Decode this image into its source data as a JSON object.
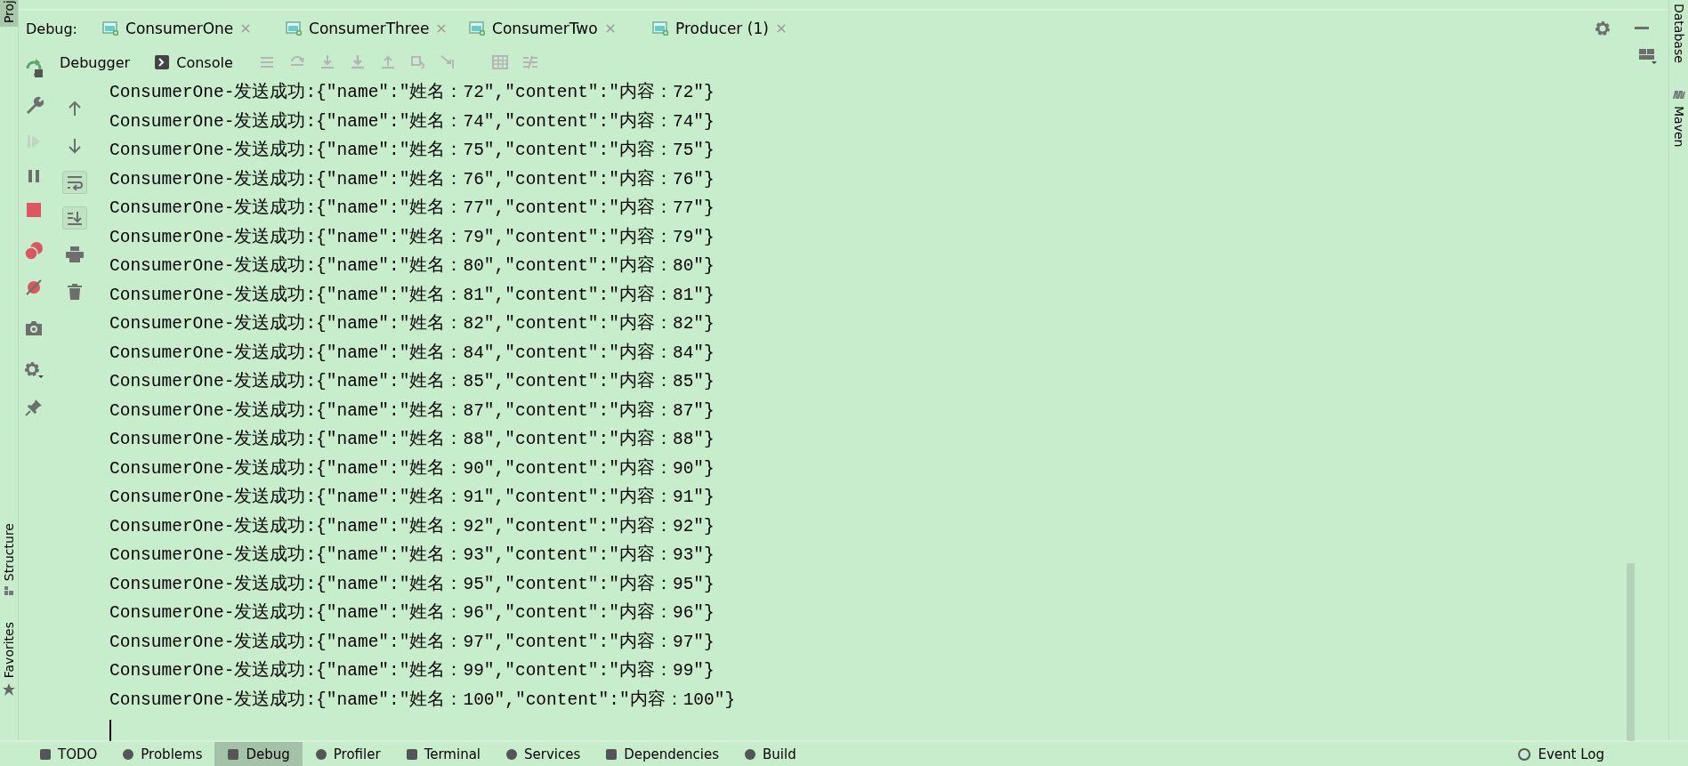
{
  "left_strip": {
    "items": [
      {
        "label": "Proj"
      },
      {
        "label": "Structure"
      },
      {
        "label": "Favorites"
      }
    ]
  },
  "debug_panel": {
    "title": "Debug:",
    "tabs": [
      {
        "label": "ConsumerOne"
      },
      {
        "label": "ConsumerThree"
      },
      {
        "label": "ConsumerTwo"
      },
      {
        "label": "Producer (1)"
      }
    ],
    "views": [
      {
        "label": "Debugger"
      },
      {
        "label": "Console"
      }
    ],
    "debug_actions": [
      {
        "kind": "rerun",
        "disabled": false
      },
      {
        "kind": "wrench",
        "disabled": false
      },
      {
        "kind": "resume",
        "disabled": true
      },
      {
        "kind": "pause",
        "disabled": false
      },
      {
        "kind": "stop",
        "disabled": false
      },
      {
        "kind": "breakpoints",
        "disabled": false
      },
      {
        "kind": "mute",
        "disabled": false
      },
      {
        "kind": "camera",
        "disabled": false
      },
      {
        "kind": "gear",
        "disabled": false
      },
      {
        "kind": "pin",
        "disabled": false
      }
    ],
    "console_tools": [
      {
        "kind": "up",
        "on": false
      },
      {
        "kind": "down",
        "on": false
      },
      {
        "kind": "wrap",
        "on": true
      },
      {
        "kind": "scroll",
        "on": true
      },
      {
        "kind": "print",
        "on": false
      },
      {
        "kind": "trash",
        "on": false
      }
    ],
    "console_lines": [
      "ConsumerOne-发送成功:{\"name\":\"姓名：72\",\"content\":\"内容：72\"}",
      "ConsumerOne-发送成功:{\"name\":\"姓名：74\",\"content\":\"内容：74\"}",
      "ConsumerOne-发送成功:{\"name\":\"姓名：75\",\"content\":\"内容：75\"}",
      "ConsumerOne-发送成功:{\"name\":\"姓名：76\",\"content\":\"内容：76\"}",
      "ConsumerOne-发送成功:{\"name\":\"姓名：77\",\"content\":\"内容：77\"}",
      "ConsumerOne-发送成功:{\"name\":\"姓名：79\",\"content\":\"内容：79\"}",
      "ConsumerOne-发送成功:{\"name\":\"姓名：80\",\"content\":\"内容：80\"}",
      "ConsumerOne-发送成功:{\"name\":\"姓名：81\",\"content\":\"内容：81\"}",
      "ConsumerOne-发送成功:{\"name\":\"姓名：82\",\"content\":\"内容：82\"}",
      "ConsumerOne-发送成功:{\"name\":\"姓名：84\",\"content\":\"内容：84\"}",
      "ConsumerOne-发送成功:{\"name\":\"姓名：85\",\"content\":\"内容：85\"}",
      "ConsumerOne-发送成功:{\"name\":\"姓名：87\",\"content\":\"内容：87\"}",
      "ConsumerOne-发送成功:{\"name\":\"姓名：88\",\"content\":\"内容：88\"}",
      "ConsumerOne-发送成功:{\"name\":\"姓名：90\",\"content\":\"内容：90\"}",
      "ConsumerOne-发送成功:{\"name\":\"姓名：91\",\"content\":\"内容：91\"}",
      "ConsumerOne-发送成功:{\"name\":\"姓名：92\",\"content\":\"内容：92\"}",
      "ConsumerOne-发送成功:{\"name\":\"姓名：93\",\"content\":\"内容：93\"}",
      "ConsumerOne-发送成功:{\"name\":\"姓名：95\",\"content\":\"内容：95\"}",
      "ConsumerOne-发送成功:{\"name\":\"姓名：96\",\"content\":\"内容：96\"}",
      "ConsumerOne-发送成功:{\"name\":\"姓名：97\",\"content\":\"内容：97\"}",
      "ConsumerOne-发送成功:{\"name\":\"姓名：99\",\"content\":\"内容：99\"}",
      "ConsumerOne-发送成功:{\"name\":\"姓名：100\",\"content\":\"内容：100\"}"
    ]
  },
  "right_strip": {
    "items": [
      {
        "label": "Database"
      },
      {
        "label": "Maven"
      }
    ]
  },
  "bottom_bar": {
    "tabs": [
      {
        "label": "TODO",
        "selected": false
      },
      {
        "label": "Problems",
        "selected": false
      },
      {
        "label": "Debug",
        "selected": true
      },
      {
        "label": "Profiler",
        "selected": false
      },
      {
        "label": "Terminal",
        "selected": false
      },
      {
        "label": "Services",
        "selected": false
      },
      {
        "label": "Dependencies",
        "selected": false
      },
      {
        "label": "Build",
        "selected": false
      }
    ],
    "event_log": "Event Log"
  }
}
